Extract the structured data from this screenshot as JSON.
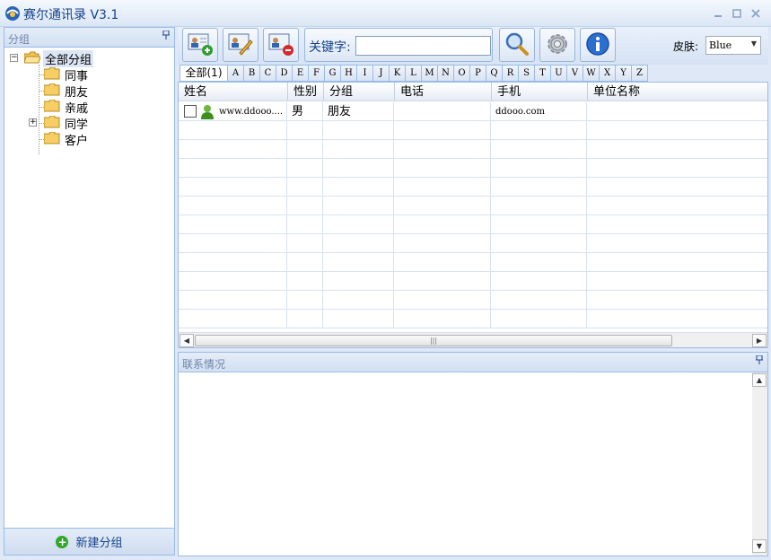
{
  "window": {
    "title": "赛尔通讯录 V3.1",
    "controls": [
      "minimize",
      "restore",
      "close"
    ]
  },
  "left_panel": {
    "header": "分组",
    "tree": {
      "root": "全部分组",
      "children": [
        {
          "label": "同事",
          "expandable": false
        },
        {
          "label": "朋友",
          "expandable": false
        },
        {
          "label": "亲戚",
          "expandable": false
        },
        {
          "label": "同学",
          "expandable": true
        },
        {
          "label": "客户",
          "expandable": false
        }
      ]
    },
    "footer_button": "新建分组"
  },
  "toolbar": {
    "buttons": [
      "add-contact-icon",
      "edit-contact-icon",
      "delete-contact-icon"
    ],
    "keyword_label": "关键字:",
    "keyword_value": "",
    "search_icon": "search-icon",
    "settings_icon": "gear-icon",
    "info_icon": "info-icon",
    "skin_label": "皮肤:",
    "skin_value": "Blue"
  },
  "letter_tabs": [
    "全部(1)",
    "A",
    "B",
    "C",
    "D",
    "E",
    "F",
    "G",
    "H",
    "I",
    "J",
    "K",
    "L",
    "M",
    "N",
    "O",
    "P",
    "Q",
    "R",
    "S",
    "T",
    "U",
    "V",
    "W",
    "X",
    "Y",
    "Z"
  ],
  "grid": {
    "columns": [
      "姓名",
      "性别",
      "分组",
      "电话",
      "手机",
      "单位名称"
    ],
    "rows": [
      {
        "name": "www.ddooo....",
        "gender": "男",
        "group": "朋友",
        "phone": "",
        "mobile": "ddooo.com",
        "company": ""
      }
    ]
  },
  "detail_panel": {
    "header": "联系情况"
  },
  "colors": {
    "accent": "#15428b",
    "border": "#99bbe8",
    "background": "#dfe8f6"
  }
}
